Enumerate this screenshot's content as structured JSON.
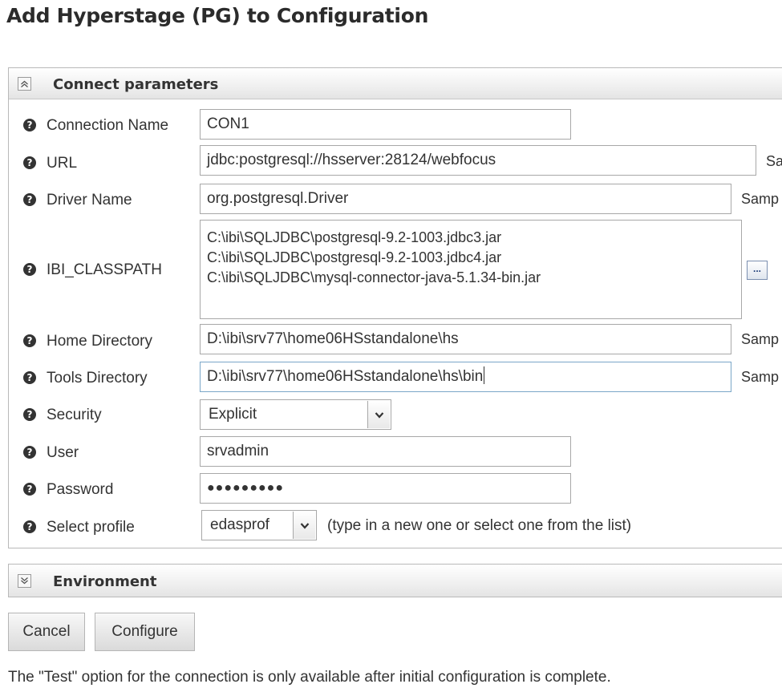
{
  "page": {
    "title": "Add Hyperstage (PG) to Configuration"
  },
  "sections": {
    "connect": {
      "title": "Connect parameters",
      "expanded": true
    },
    "environment": {
      "title": "Environment",
      "expanded": false
    }
  },
  "fields": {
    "connection_name": {
      "label": "Connection Name",
      "value": "CON1"
    },
    "url": {
      "label": "URL",
      "value": "jdbc:postgresql://hsserver:28124/webfocus",
      "sample": "Sa"
    },
    "driver_name": {
      "label": "Driver Name",
      "value": "org.postgresql.Driver",
      "sample": "Samp"
    },
    "ibi_classpath": {
      "label": "IBI_CLASSPATH",
      "lines": [
        "C:\\ibi\\SQLJDBC\\postgresql-9.2-1003.jdbc3.jar",
        "C:\\ibi\\SQLJDBC\\postgresql-9.2-1003.jdbc4.jar",
        "C:\\ibi\\SQLJDBC\\mysql-connector-java-5.1.34-bin.jar"
      ],
      "browse_label": "..."
    },
    "home_directory": {
      "label": "Home Directory",
      "value": "D:\\ibi\\srv77\\home06HSstandalone\\hs",
      "sample": "Samp"
    },
    "tools_directory": {
      "label": "Tools Directory",
      "value": "D:\\ibi\\srv77\\home06HSstandalone\\hs\\bin",
      "sample": "Samp"
    },
    "security": {
      "label": "Security",
      "value": "Explicit"
    },
    "user": {
      "label": "User",
      "value": "srvadmin"
    },
    "password": {
      "label": "Password",
      "value": "●●●●●●●●●"
    },
    "select_profile": {
      "label": "Select profile",
      "value": "edasprof",
      "hint": "(type in a new one or select one from the list)"
    }
  },
  "buttons": {
    "cancel": "Cancel",
    "configure": "Configure"
  },
  "footnote": "The \"Test\" option for the connection is only available after initial configuration is complete.",
  "icons": {
    "help": "help-icon",
    "collapse": "chevron-up-icon",
    "expand": "chevron-down-icon"
  },
  "colors": {
    "help_icon": "#333333",
    "focus_border": "#7aa6c8"
  }
}
